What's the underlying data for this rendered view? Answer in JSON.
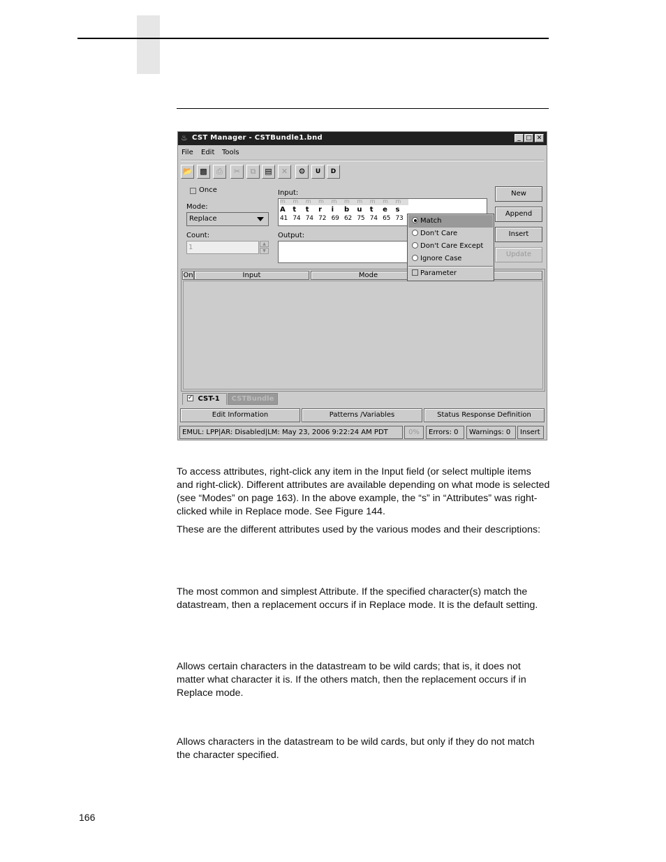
{
  "page": {
    "page_number": "166"
  },
  "window": {
    "title": "CST Manager - CSTBundle1.bnd",
    "controls": {
      "minimize": "_",
      "maximize": "□",
      "close": "✕"
    },
    "menu": [
      {
        "label": "File",
        "mnemonic": "F"
      },
      {
        "label": "Edit",
        "mnemonic": "E"
      },
      {
        "label": "Tools",
        "mnemonic": "T"
      }
    ],
    "toolbar": [
      {
        "name": "open-folder-icon",
        "glyph": "📂",
        "enabled": true
      },
      {
        "name": "save-icon",
        "glyph": "💾",
        "enabled": true
      },
      {
        "name": "print-icon",
        "glyph": "🖶",
        "enabled": false
      },
      {
        "name": "cut-icon",
        "glyph": "✂",
        "enabled": false
      },
      {
        "name": "copy-icon",
        "glyph": "⎘",
        "enabled": false
      },
      {
        "name": "paste-icon",
        "glyph": "📋",
        "enabled": true
      },
      {
        "name": "delete-icon",
        "glyph": "✕",
        "enabled": false
      },
      {
        "name": "tools-icon",
        "glyph": "⚙",
        "enabled": true
      },
      {
        "name": "upload-icon",
        "glyph": "U",
        "enabled": true
      },
      {
        "name": "download-icon",
        "glyph": "D",
        "enabled": true
      }
    ],
    "form": {
      "once_label": "Once",
      "once_checked": false,
      "mode_label": "Mode:",
      "mode_value": "Replace",
      "count_label": "Count:",
      "count_value": "1",
      "input_label": "Input:",
      "output_label": "Output:",
      "output_value": "",
      "input_marker": "m",
      "input_chars": [
        "A",
        "t",
        "t",
        "r",
        "i",
        "b",
        "u",
        "t",
        "e",
        "s"
      ],
      "input_hex": [
        "41",
        "74",
        "74",
        "72",
        "69",
        "62",
        "75",
        "74",
        "65",
        "73"
      ]
    },
    "buttons": {
      "new": "New",
      "append": "Append",
      "insert": "Insert",
      "update": "Update"
    },
    "context_menu": {
      "radio_items": [
        {
          "label": "Match",
          "selected": true
        },
        {
          "label": "Don't Care",
          "selected": false
        },
        {
          "label": "Don't Care Except",
          "selected": false
        },
        {
          "label": "Ignore Case",
          "selected": false
        }
      ],
      "check_item": {
        "label": "Parameter",
        "checked": false
      }
    },
    "table": {
      "columns": [
        "On",
        "Input",
        "Mode",
        "",
        "t"
      ],
      "rows": []
    },
    "tabs": [
      {
        "label": "CST-1",
        "active": true,
        "checked": true
      },
      {
        "label": "CSTBundle",
        "active": false
      }
    ],
    "bottom_buttons": [
      "Edit Information",
      "Patterns /Variables",
      "Status Response Definition"
    ],
    "status": {
      "info": "EMUL: LPP|AR: Disabled|LM: May 23, 2006 9:22:24 AM PDT",
      "progress": "0%",
      "errors": "Errors: 0",
      "warnings": "Warnings: 0",
      "insert_mode": "Insert"
    }
  },
  "text": {
    "p1": "To access attributes, right-click any item in the Input field (or select multiple items and right-click). Different attributes are available depending on what mode is selected (see “Modes” on page 163). In the above example, the “s” in “Attributes” was right-clicked while in Replace mode. See Figure 144.",
    "p2": "These are the different attributes used by the various modes and their descriptions:",
    "match_desc": "The most common and simplest Attribute. If the specified character(s) match the datastream, then a replacement occurs if in Replace mode. It is the default setting.",
    "dont_care_desc": "Allows certain characters in the datastream to be wild cards; that is, it does not matter what character it is. If the others match, then the replacement occurs if in Replace mode.",
    "dont_care_except_desc": "Allows characters in the datastream to be wild cards, but only if they do not match the character specified."
  }
}
